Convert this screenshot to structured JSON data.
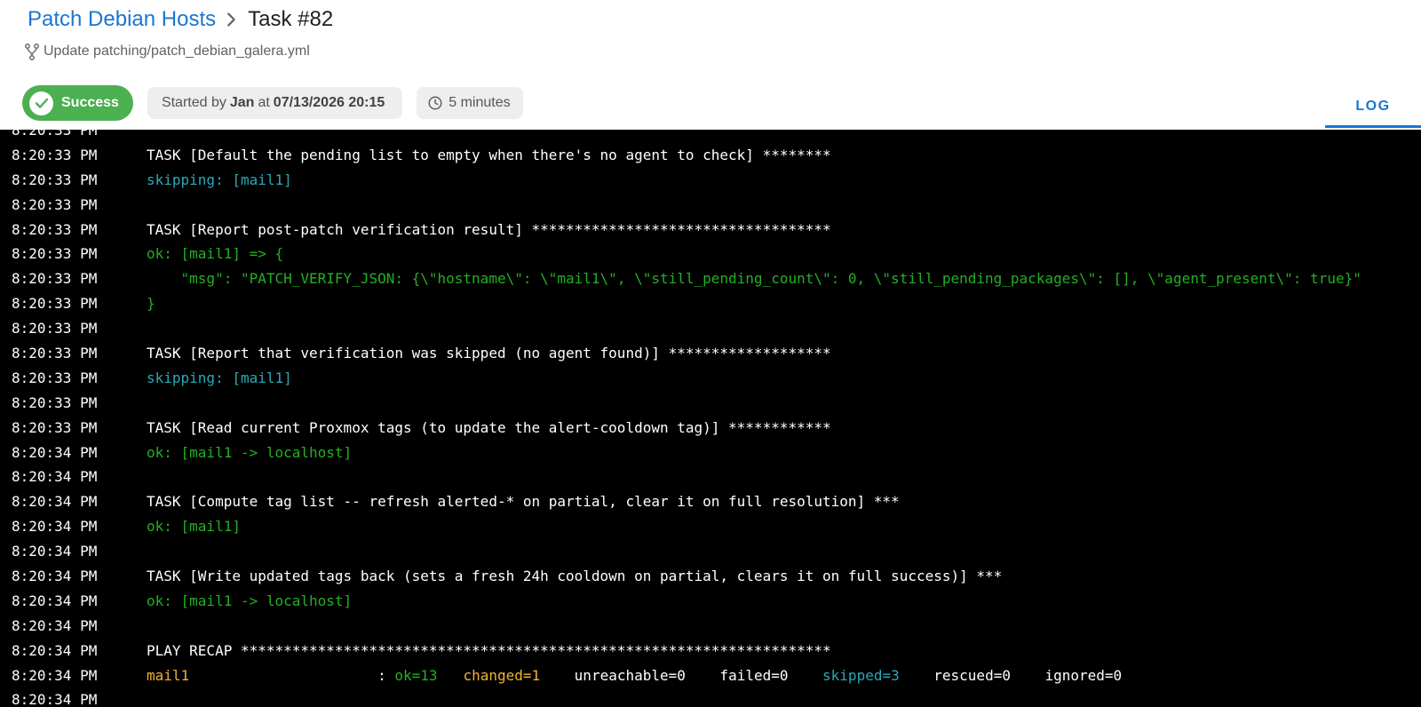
{
  "breadcrumb": {
    "parent": "Patch Debian Hosts",
    "current": "Task #82"
  },
  "commit_message": "Update patching/patch_debian_galera.yml",
  "status": {
    "label": "Success",
    "color": "#4caf50"
  },
  "started": {
    "prefix": "Started by",
    "user": "Jan",
    "at_word": "at",
    "datetime": "07/13/2026 20:15"
  },
  "duration": "5 minutes",
  "tab": {
    "label": "LOG"
  },
  "colors": {
    "accent": "#1976d2",
    "terminal_bg": "#000000",
    "ok": "#23b023",
    "skipping": "#2aa9b9",
    "changed": "#f2b233"
  },
  "log": [
    {
      "time": "8:20:33 PM",
      "segments": []
    },
    {
      "time": "8:20:33 PM",
      "segments": [
        {
          "text": "TASK [Default the pending list to empty when there's no agent to check] ********",
          "color": "white"
        }
      ]
    },
    {
      "time": "8:20:33 PM",
      "segments": [
        {
          "text": "skipping: [mail1]",
          "color": "cyan"
        }
      ]
    },
    {
      "time": "8:20:33 PM",
      "segments": []
    },
    {
      "time": "8:20:33 PM",
      "segments": [
        {
          "text": "TASK [Report post-patch verification result] ***********************************",
          "color": "white"
        }
      ]
    },
    {
      "time": "8:20:33 PM",
      "segments": [
        {
          "text": "ok: [mail1] => {",
          "color": "green"
        }
      ]
    },
    {
      "time": "8:20:33 PM",
      "segments": [
        {
          "text": "    \"msg\": \"PATCH_VERIFY_JSON: {\\\"hostname\\\": \\\"mail1\\\", \\\"still_pending_count\\\": 0, \\\"still_pending_packages\\\": [], \\\"agent_present\\\": true}\"",
          "color": "green"
        }
      ]
    },
    {
      "time": "8:20:33 PM",
      "segments": [
        {
          "text": "}",
          "color": "green"
        }
      ]
    },
    {
      "time": "8:20:33 PM",
      "segments": []
    },
    {
      "time": "8:20:33 PM",
      "segments": [
        {
          "text": "TASK [Report that verification was skipped (no agent found)] *******************",
          "color": "white"
        }
      ]
    },
    {
      "time": "8:20:33 PM",
      "segments": [
        {
          "text": "skipping: [mail1]",
          "color": "cyan"
        }
      ]
    },
    {
      "time": "8:20:33 PM",
      "segments": []
    },
    {
      "time": "8:20:33 PM",
      "segments": [
        {
          "text": "TASK [Read current Proxmox tags (to update the alert-cooldown tag)] ************",
          "color": "white"
        }
      ]
    },
    {
      "time": "8:20:34 PM",
      "segments": [
        {
          "text": "ok: [mail1 -> localhost]",
          "color": "green"
        }
      ]
    },
    {
      "time": "8:20:34 PM",
      "segments": []
    },
    {
      "time": "8:20:34 PM",
      "segments": [
        {
          "text": "TASK [Compute tag list -- refresh alerted-* on partial, clear it on full resolution] ***",
          "color": "white"
        }
      ]
    },
    {
      "time": "8:20:34 PM",
      "segments": [
        {
          "text": "ok: [mail1]",
          "color": "green"
        }
      ]
    },
    {
      "time": "8:20:34 PM",
      "segments": []
    },
    {
      "time": "8:20:34 PM",
      "segments": [
        {
          "text": "TASK [Write updated tags back (sets a fresh 24h cooldown on partial, clears it on full success)] ***",
          "color": "white"
        }
      ]
    },
    {
      "time": "8:20:34 PM",
      "segments": [
        {
          "text": "ok: [mail1 -> localhost]",
          "color": "green"
        }
      ]
    },
    {
      "time": "8:20:34 PM",
      "segments": []
    },
    {
      "time": "8:20:34 PM",
      "segments": [
        {
          "text": "PLAY RECAP *********************************************************************",
          "color": "white"
        }
      ]
    },
    {
      "time": "8:20:34 PM",
      "segments": [
        {
          "text": "mail1",
          "color": "orange"
        },
        {
          "text": "                      : ",
          "color": "white"
        },
        {
          "text": "ok=13",
          "color": "green"
        },
        {
          "text": "   ",
          "color": "white"
        },
        {
          "text": "changed=1",
          "color": "orange"
        },
        {
          "text": "    unreachable=0    failed=0    ",
          "color": "white"
        },
        {
          "text": "skipped=3",
          "color": "cyan"
        },
        {
          "text": "    rescued=0    ignored=0",
          "color": "white"
        }
      ]
    },
    {
      "time": "8:20:34 PM",
      "segments": []
    }
  ]
}
